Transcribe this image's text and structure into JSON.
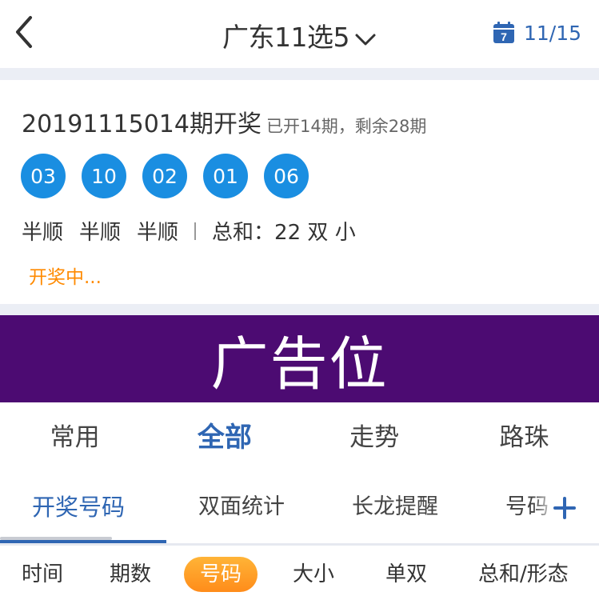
{
  "header": {
    "title": "广东11选5",
    "date": "11/15",
    "calendar_day": "7",
    "icons": {
      "back": "back-chevron-icon",
      "dropdown": "chevron-down-icon",
      "calendar": "calendar-icon"
    }
  },
  "draw": {
    "issue": "20191115014期开奖",
    "progress": "已开14期，剩余28期",
    "balls": [
      "03",
      "10",
      "02",
      "01",
      "06"
    ],
    "forms": [
      "半顺",
      "半顺",
      "半顺"
    ],
    "sum_label": "总和：22",
    "sum_parity": "双",
    "sum_size": "小",
    "status": "开奖中..."
  },
  "ad": {
    "text": "广告位"
  },
  "categories": [
    {
      "label": "常用",
      "active": false
    },
    {
      "label": "全部",
      "active": true
    },
    {
      "label": "走势",
      "active": false
    },
    {
      "label": "路珠",
      "active": false
    }
  ],
  "subtabs": [
    {
      "label": "开奖号码",
      "active": true
    },
    {
      "label": "双面统计",
      "active": false
    },
    {
      "label": "长龙提醒",
      "active": false
    },
    {
      "label": "号码",
      "active": false
    }
  ],
  "filters": [
    {
      "label": "时间",
      "active": false
    },
    {
      "label": "期数",
      "active": false
    },
    {
      "label": "号码",
      "active": true
    },
    {
      "label": "大小",
      "active": false
    },
    {
      "label": "单双",
      "active": false
    },
    {
      "label": "总和/形态",
      "active": false
    }
  ],
  "colors": {
    "accent": "#2f66b3",
    "ball": "#1a8ee1",
    "status": "#ff8a00",
    "ad_bg": "#4c0b72",
    "filter_active": "#ff9a26"
  }
}
